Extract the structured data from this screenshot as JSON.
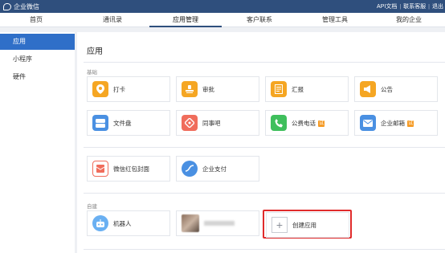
{
  "brand": {
    "name": "企业微信",
    "icon": "chat-bubble-icon"
  },
  "top_links": [
    "API文档",
    "联系客服",
    "退出"
  ],
  "nav": {
    "items": [
      {
        "label": "首页",
        "active": false
      },
      {
        "label": "通讯录",
        "active": false
      },
      {
        "label": "应用管理",
        "active": true
      },
      {
        "label": "客户联系",
        "active": false
      },
      {
        "label": "管理工具",
        "active": false
      },
      {
        "label": "我的企业",
        "active": false
      }
    ]
  },
  "sidebar": {
    "items": [
      {
        "label": "应用",
        "active": true
      },
      {
        "label": "小程序",
        "active": false
      },
      {
        "label": "硬件",
        "active": false
      }
    ]
  },
  "main": {
    "title": "应用",
    "basic_label": "基础",
    "custom_label": "自建",
    "basic_apps": [
      {
        "label": "打卡",
        "color": "#f5a623",
        "icon": "location-pin-icon",
        "badge": ""
      },
      {
        "label": "审批",
        "color": "#f5a623",
        "icon": "stamp-icon",
        "badge": ""
      },
      {
        "label": "汇报",
        "color": "#f5a623",
        "icon": "report-icon",
        "badge": ""
      },
      {
        "label": "公告",
        "color": "#f5a623",
        "icon": "megaphone-icon",
        "badge": ""
      },
      {
        "label": "文件盘",
        "color": "#4a90e2",
        "icon": "disk-icon",
        "badge": ""
      },
      {
        "label": "同事吧",
        "color": "#f06d5c",
        "icon": "diamond-icon",
        "badge": ""
      },
      {
        "label": "公费电话",
        "color": "#3fbf5c",
        "icon": "phone-icon",
        "badge": "试"
      },
      {
        "label": "企业邮箱",
        "color": "#4a90e2",
        "icon": "mail-icon",
        "badge": "试"
      },
      {
        "label": "微信红包封面",
        "color": "#f06d5c",
        "icon": "red-envelope-icon",
        "badge": ""
      },
      {
        "label": "企业支付",
        "color": "#4a90e2",
        "icon": "payment-icon",
        "badge": ""
      }
    ],
    "custom_apps": [
      {
        "label": "机器人",
        "color": "#6ab0f2",
        "icon": "robot-icon"
      },
      {
        "label": "",
        "icon": "blurred-avatar"
      }
    ],
    "create_label": "创建应用"
  }
}
